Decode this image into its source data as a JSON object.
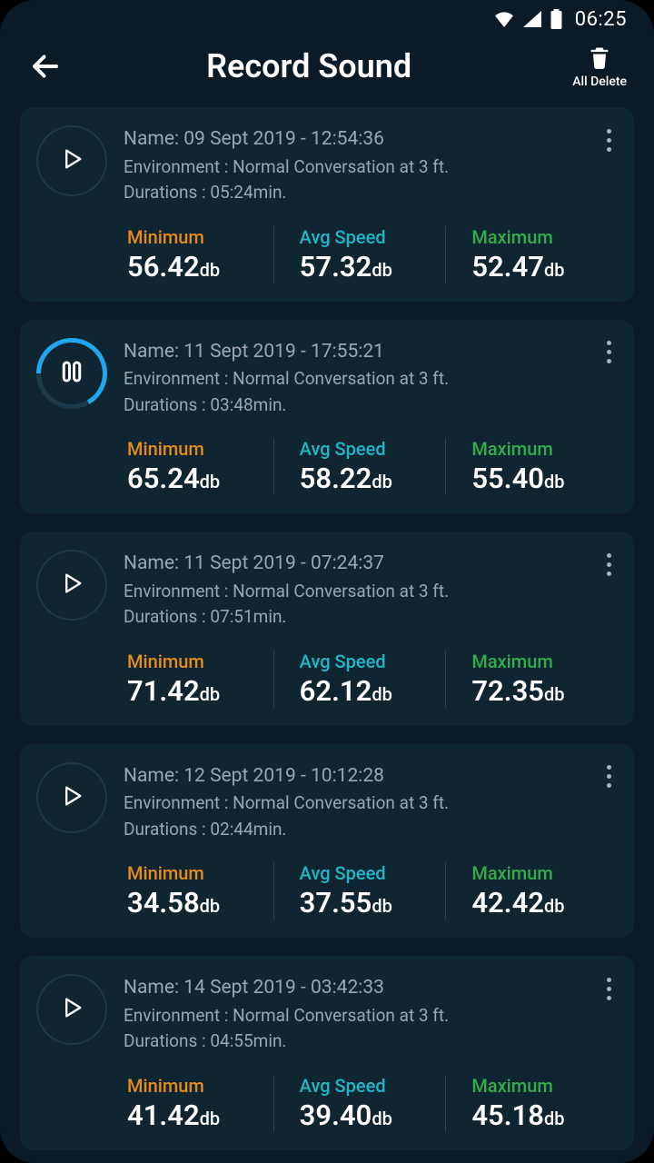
{
  "statusbar": {
    "time": "06:25"
  },
  "header": {
    "title": "Record Sound",
    "delete_label": "All Delete"
  },
  "labels": {
    "name_prefix": "Name: ",
    "env_prefix": "Environment : ",
    "dur_prefix": "Durations : ",
    "min": "Minimum",
    "avg": "Avg Speed",
    "max": "Maximum",
    "unit": "db"
  },
  "records": [
    {
      "name": "09 Sept 2019 - 12:54:36",
      "environment": "Normal Conversation at 3 ft.",
      "duration": "05:24min.",
      "playing": false,
      "min": "56.42",
      "avg": "57.32",
      "max": "52.47"
    },
    {
      "name": "11 Sept 2019 - 17:55:21",
      "environment": "Normal Conversation at 3 ft.",
      "duration": "03:48min.",
      "playing": true,
      "min": "65.24",
      "avg": "58.22",
      "max": "55.40"
    },
    {
      "name": "11 Sept 2019 - 07:24:37",
      "environment": "Normal Conversation at 3 ft.",
      "duration": "07:51min.",
      "playing": false,
      "min": "71.42",
      "avg": "62.12",
      "max": "72.35"
    },
    {
      "name": "12 Sept 2019 - 10:12:28",
      "environment": "Normal Conversation at 3 ft.",
      "duration": "02:44min.",
      "playing": false,
      "min": "34.58",
      "avg": "37.55",
      "max": "42.42"
    },
    {
      "name": "14 Sept 2019 - 03:42:33",
      "environment": "Normal Conversation at 3 ft.",
      "duration": "04:55min.",
      "playing": false,
      "min": "41.42",
      "avg": "39.40",
      "max": "45.18"
    }
  ]
}
